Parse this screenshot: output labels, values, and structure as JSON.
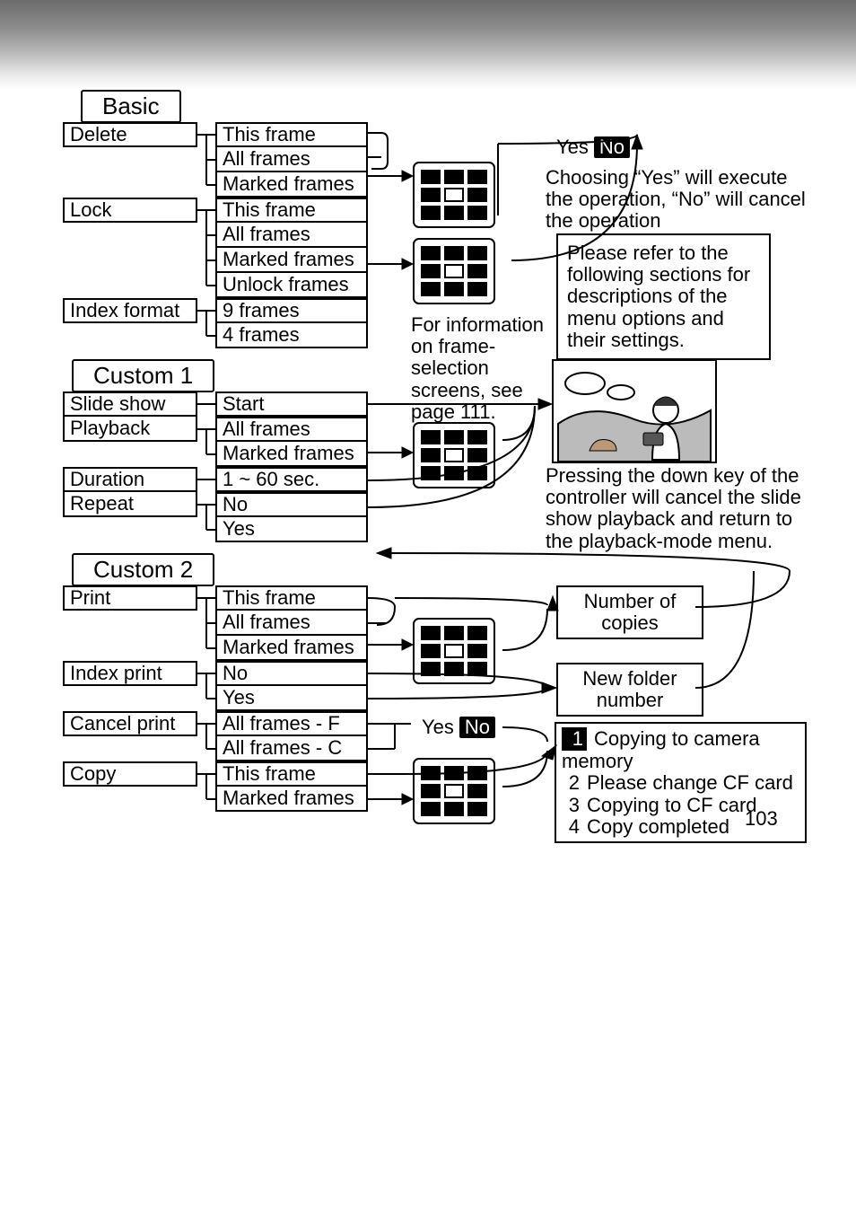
{
  "basic": {
    "tab": "Basic",
    "delete": {
      "label": "Delete",
      "opts": [
        "This frame",
        "All frames",
        "Marked frames"
      ]
    },
    "lock": {
      "label": "Lock",
      "opts": [
        "This frame",
        "All frames",
        "Marked frames",
        "Unlock frames"
      ]
    },
    "index": {
      "label": "Index format",
      "opts": [
        "9 frames",
        "4 frames"
      ]
    }
  },
  "custom1": {
    "tab": "Custom 1",
    "slideshow": {
      "label": "Slide show",
      "opts": [
        "Start"
      ]
    },
    "playback": {
      "label": "Playback",
      "opts": [
        "All frames",
        "Marked frames"
      ]
    },
    "duration": {
      "label": "Duration",
      "opts": [
        "1 ~ 60 sec."
      ]
    },
    "repeat": {
      "label": "Repeat",
      "opts": [
        "No",
        "Yes"
      ]
    }
  },
  "custom2": {
    "tab": "Custom 2",
    "print": {
      "label": "Print",
      "opts": [
        "This frame",
        "All frames",
        "Marked frames"
      ]
    },
    "indexprint": {
      "label": "Index print",
      "opts": [
        "No",
        "Yes"
      ]
    },
    "cancel": {
      "label": "Cancel print",
      "opts": [
        "All frames - F",
        "All frames - C"
      ]
    },
    "copy": {
      "label": "Copy",
      "opts": [
        "This frame",
        "Marked frames"
      ]
    }
  },
  "yesno": {
    "yes": "Yes",
    "no": "No"
  },
  "notes": {
    "exec": "Choosing “Yes” will execute the operation, “No” will cancel the operation",
    "refer": "Please refer to the following sections for descriptions of the menu options and their settings.",
    "frameinfo": "For information on frame-selection screens, see page 111.",
    "slidecancel": "Pressing the down key of the controller will cancel the slide show playback and return to the playback-mode menu.",
    "copies": "Number of copies",
    "newfolder": "New folder number"
  },
  "copysteps": [
    "Copying to camera memory",
    "Please change CF card",
    "Copying to CF card",
    "Copy completed"
  ],
  "pagenum": "103"
}
